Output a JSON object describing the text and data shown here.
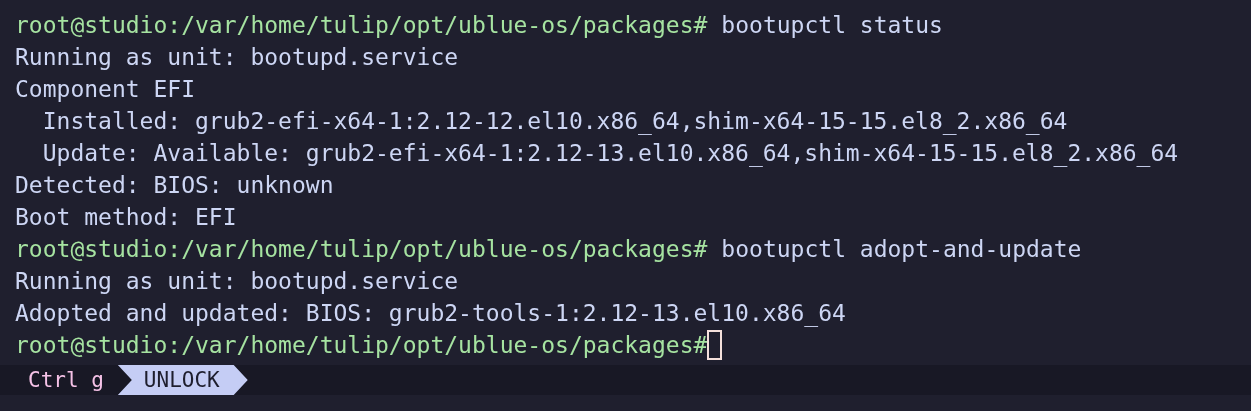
{
  "terminal": {
    "lines": [
      {
        "kind": "prompt",
        "prompt": "root@studio:/var/home/tulip/opt/ublue-os/packages#",
        "command": "bootupctl status"
      },
      {
        "kind": "output",
        "text": "Running as unit: bootupd.service"
      },
      {
        "kind": "output",
        "text": "Component EFI"
      },
      {
        "kind": "output",
        "text": "  Installed: grub2-efi-x64-1:2.12-12.el10.x86_64,shim-x64-15-15.el8_2.x86_64"
      },
      {
        "kind": "output",
        "text": "  Update: Available: grub2-efi-x64-1:2.12-13.el10.x86_64,shim-x64-15-15.el8_2.x86_64"
      },
      {
        "kind": "output",
        "text": "Detected: BIOS: unknown"
      },
      {
        "kind": "output",
        "text": "Boot method: EFI"
      },
      {
        "kind": "prompt",
        "prompt": "root@studio:/var/home/tulip/opt/ublue-os/packages#",
        "command": "bootupctl adopt-and-update"
      },
      {
        "kind": "output",
        "text": "Running as unit: bootupd.service"
      },
      {
        "kind": "output",
        "text": "Adopted and updated: BIOS: grub2-tools-1:2.12-13.el10.x86_64"
      },
      {
        "kind": "prompt",
        "prompt": "root@studio:/var/home/tulip/opt/ublue-os/packages#",
        "cursor": true
      }
    ]
  },
  "status_bar": {
    "key_hint": "Ctrl g",
    "mode": "UNLOCK"
  }
}
